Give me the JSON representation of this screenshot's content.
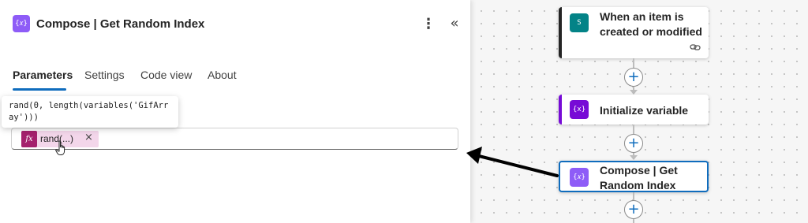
{
  "panel": {
    "icon": "{𝑥}",
    "icon_name": "compose-icon",
    "title": "Compose | Get Random Index",
    "more_label": "⋮",
    "collapse_label": "«",
    "tabs": [
      {
        "label": "Parameters",
        "active": true
      },
      {
        "label": "Settings",
        "active": false
      },
      {
        "label": "Code view",
        "active": false
      },
      {
        "label": "About",
        "active": false
      }
    ],
    "tooltip": "rand(0, length(variables('GifArray')))",
    "inputs_token": {
      "icon": "fx",
      "label": "rand(...)",
      "remove": "×"
    }
  },
  "canvas": {
    "nodes": [
      {
        "title": "When an item is created or modified",
        "icon_name": "sharepoint-icon",
        "icon": "S",
        "accent": "#242424",
        "icon_color": "#038387",
        "footer_icon": "link-icon"
      },
      {
        "title": "Initialize variable",
        "icon_name": "variable-icon",
        "icon": "{x}",
        "accent": "#770bd6",
        "icon_color": "#770bd6"
      },
      {
        "title": "Compose | Get Random Index",
        "icon_name": "compose-icon",
        "icon": "{𝑥}",
        "accent": "#8e5cf7",
        "icon_color": "#8e5cf7",
        "selected": true
      }
    ],
    "add_label": "+"
  },
  "colors": {
    "accent_blue": "#0f6cbd",
    "token_bg": "#f3d6ea",
    "fx_bg": "#a4206d"
  }
}
